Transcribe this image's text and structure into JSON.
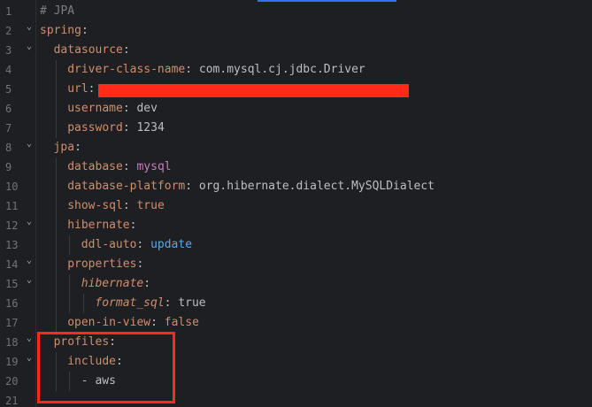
{
  "colors": {
    "background": "#1e1f22",
    "key": "#cf8e6d",
    "value": "#bcbec4",
    "purple_value": "#c77dbb",
    "blue_value": "#56a8f5",
    "comment": "#7a7e85",
    "line_number": "#6f737a",
    "highlight": "#ff2a1a",
    "tab_indicator": "#3574f0"
  },
  "lines": [
    {
      "number": "1",
      "fold": "",
      "tokens": [
        {
          "text": "# JPA",
          "role": "comment"
        }
      ]
    },
    {
      "number": "2",
      "fold": "chevron-down",
      "tokens": [
        {
          "text": "spring",
          "role": "key"
        },
        {
          "text": ":",
          "role": "colon"
        }
      ]
    },
    {
      "number": "3",
      "fold": "chevron-down",
      "tokens": [
        {
          "text": "datasource",
          "role": "key"
        },
        {
          "text": ":",
          "role": "colon"
        }
      ]
    },
    {
      "number": "4",
      "fold": "",
      "tokens": [
        {
          "text": "driver-class-name",
          "role": "key"
        },
        {
          "text": ": ",
          "role": "colon"
        },
        {
          "text": "com.mysql.cj.jdbc.Driver",
          "role": "val"
        }
      ]
    },
    {
      "number": "5",
      "fold": "",
      "tokens": [
        {
          "text": "url",
          "role": "key"
        },
        {
          "text": ":",
          "role": "colon"
        }
      ]
    },
    {
      "number": "6",
      "fold": "",
      "tokens": [
        {
          "text": "username",
          "role": "key"
        },
        {
          "text": ": ",
          "role": "colon"
        },
        {
          "text": "dev",
          "role": "val"
        }
      ]
    },
    {
      "number": "7",
      "fold": "",
      "tokens": [
        {
          "text": "password",
          "role": "key"
        },
        {
          "text": ": ",
          "role": "colon"
        },
        {
          "text": "1234",
          "role": "val"
        }
      ]
    },
    {
      "number": "8",
      "fold": "chevron-down",
      "tokens": [
        {
          "text": "jpa",
          "role": "key"
        },
        {
          "text": ":",
          "role": "colon"
        }
      ]
    },
    {
      "number": "9",
      "fold": "",
      "tokens": [
        {
          "text": "database",
          "role": "key"
        },
        {
          "text": ": ",
          "role": "colon"
        },
        {
          "text": "mysql",
          "role": "purple"
        }
      ]
    },
    {
      "number": "10",
      "fold": "",
      "tokens": [
        {
          "text": "database-platform",
          "role": "key"
        },
        {
          "text": ": ",
          "role": "colon"
        },
        {
          "text": "org.hibernate.dialect.MySQLDialect",
          "role": "val"
        }
      ]
    },
    {
      "number": "11",
      "fold": "",
      "tokens": [
        {
          "text": "show-sql",
          "role": "key"
        },
        {
          "text": ": ",
          "role": "colon"
        },
        {
          "text": "true",
          "role": "kw"
        }
      ]
    },
    {
      "number": "12",
      "fold": "chevron-down",
      "tokens": [
        {
          "text": "hibernate",
          "role": "key"
        },
        {
          "text": ":",
          "role": "colon"
        }
      ]
    },
    {
      "number": "13",
      "fold": "",
      "tokens": [
        {
          "text": "ddl-auto",
          "role": "key"
        },
        {
          "text": ": ",
          "role": "colon"
        },
        {
          "text": "update",
          "role": "blue"
        }
      ]
    },
    {
      "number": "14",
      "fold": "chevron-down",
      "tokens": [
        {
          "text": "properties",
          "role": "key"
        },
        {
          "text": ":",
          "role": "colon"
        }
      ]
    },
    {
      "number": "15",
      "fold": "chevron-down",
      "tokens": [
        {
          "text": "hibernate",
          "role": "key-italic"
        },
        {
          "text": ":",
          "role": "colon"
        }
      ]
    },
    {
      "number": "16",
      "fold": "",
      "tokens": [
        {
          "text": "format_sql",
          "role": "key-italic"
        },
        {
          "text": ": ",
          "role": "colon"
        },
        {
          "text": "true",
          "role": "val"
        }
      ]
    },
    {
      "number": "17",
      "fold": "",
      "tokens": [
        {
          "text": "open-in-view",
          "role": "key"
        },
        {
          "text": ": ",
          "role": "colon"
        },
        {
          "text": "false",
          "role": "kw"
        }
      ]
    },
    {
      "number": "18",
      "fold": "chevron-down",
      "tokens": [
        {
          "text": "profiles",
          "role": "key"
        },
        {
          "text": ":",
          "role": "colon"
        }
      ]
    },
    {
      "number": "19",
      "fold": "chevron-down",
      "tokens": [
        {
          "text": "include",
          "role": "key"
        },
        {
          "text": ":",
          "role": "colon"
        }
      ]
    },
    {
      "number": "20",
      "fold": "",
      "tokens": [
        {
          "text": "- aws",
          "role": "val"
        }
      ]
    },
    {
      "number": "21",
      "fold": "",
      "tokens": []
    }
  ]
}
